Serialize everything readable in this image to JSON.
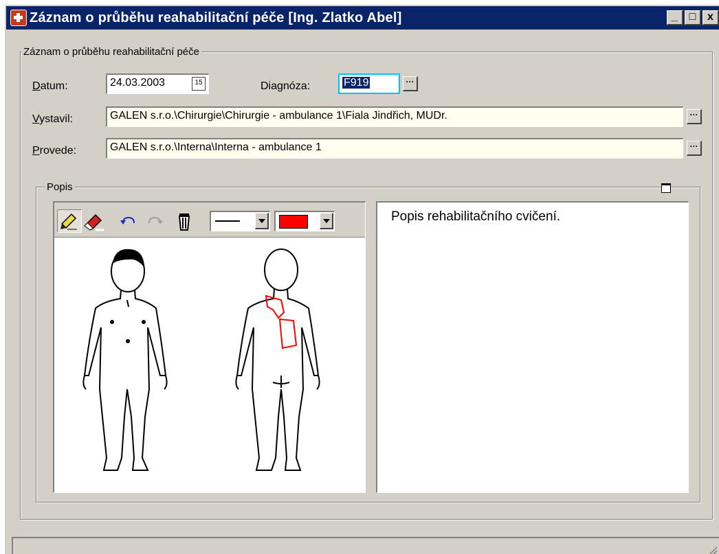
{
  "window": {
    "title": "Záznam o průběhu reahabilitační péče  [Ing. Zlatko Abel]",
    "buttons": {
      "minimize": "_",
      "maximize": "□",
      "close": "x"
    }
  },
  "record_group": {
    "legend": "Záznam o průběhu reahabilitační péče",
    "datum": {
      "label_key": "D",
      "label_rest": "atum:",
      "value": "24.03.2003",
      "calendar_glyph": "15"
    },
    "diagnoza": {
      "label": "Diagnóza:",
      "value": "F919"
    },
    "vystavil": {
      "label_key": "V",
      "label_rest": "ystavil:",
      "value": "GALEN s.r.o.\\Chirurgie\\Chirurgie - ambulance 1\\Fiala Jindřich, MUDr."
    },
    "provede": {
      "label_key": "P",
      "label_rest": "rovede:",
      "value": "GALEN s.r.o.\\Interna\\Interna - ambulance 1"
    },
    "ellipsis": "···"
  },
  "popis_group": {
    "legend": "Popis",
    "toolbar": {
      "icons": [
        "pencil-icon",
        "eraser-icon",
        "undo-icon",
        "redo-icon",
        "trash-icon"
      ],
      "line_style": "solid",
      "pen_color": "#ff0000"
    },
    "description": "Popis rehabilitačního cvičení."
  },
  "colors": {
    "title_bar": "#0a246a",
    "face": "#d4d0c8",
    "field_yellow": "#fffff0",
    "drawing": "#ff0000"
  }
}
